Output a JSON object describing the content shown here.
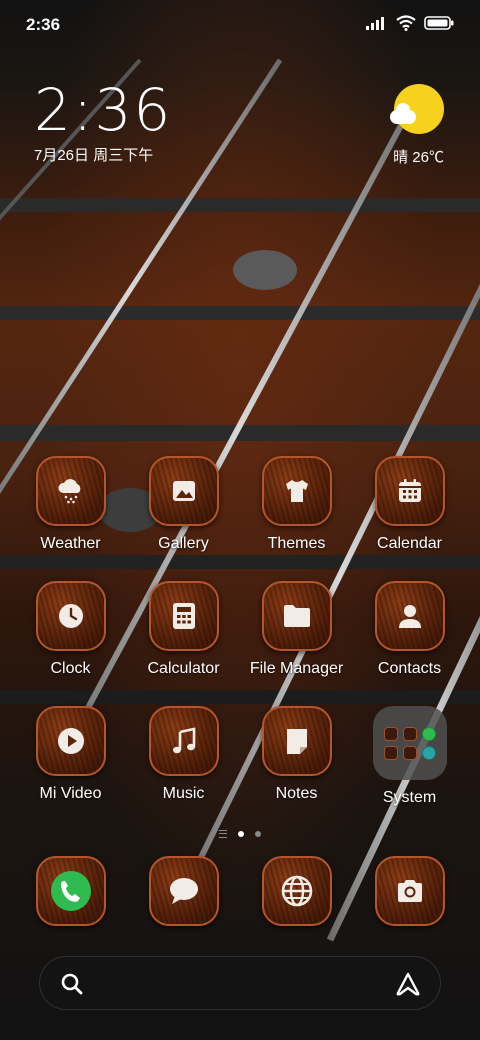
{
  "status_bar": {
    "time": "2:36",
    "icons": [
      "signal-icon",
      "wifi-icon",
      "battery-icon"
    ]
  },
  "clock_widget": {
    "time": "2:36",
    "date": "7月26日 周三下午"
  },
  "weather_widget": {
    "icon": "sun-cloud-icon",
    "text": "晴 26℃"
  },
  "apps": [
    {
      "label": "Weather",
      "icon": "weather-icon"
    },
    {
      "label": "Gallery",
      "icon": "gallery-icon"
    },
    {
      "label": "Themes",
      "icon": "themes-icon"
    },
    {
      "label": "Calendar",
      "icon": "calendar-icon"
    },
    {
      "label": "Clock",
      "icon": "clock-icon"
    },
    {
      "label": "Calculator",
      "icon": "calculator-icon"
    },
    {
      "label": "File Manager",
      "icon": "folder-icon"
    },
    {
      "label": "Contacts",
      "icon": "contacts-icon"
    },
    {
      "label": "Mi Video",
      "icon": "play-icon"
    },
    {
      "label": "Music",
      "icon": "music-icon"
    },
    {
      "label": "Notes",
      "icon": "notes-icon"
    },
    {
      "label": "System",
      "icon": "folder-system-icon"
    }
  ],
  "page_indicator": {
    "pages": 2,
    "current": 1
  },
  "dock": [
    {
      "icon": "phone-icon"
    },
    {
      "icon": "messages-icon"
    },
    {
      "icon": "browser-icon"
    },
    {
      "icon": "camera-icon"
    }
  ],
  "search_bar": {
    "left_icon": "search-icon",
    "right_icon": "assistant-icon"
  },
  "colors": {
    "accent_wood": "#b4552a",
    "sun": "#f6d11d",
    "phone_green": "#2fbb4f"
  }
}
